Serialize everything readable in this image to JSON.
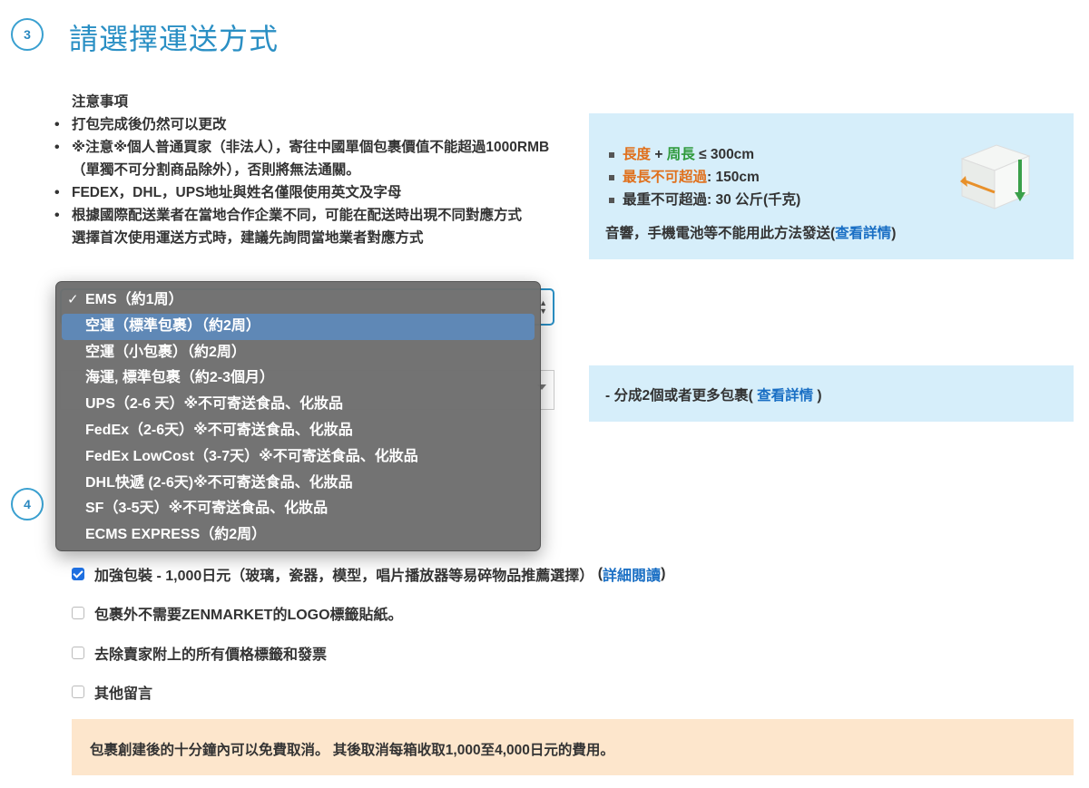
{
  "step3": {
    "number": "3",
    "title": "請選擇運送方式"
  },
  "step4": {
    "number": "4"
  },
  "notes": {
    "heading": "注意事項",
    "items": [
      "打包完成後仍然可以更改",
      "※注意※個人普通買家（非法人），寄往中國單個包裹價值不能超過1000RMB（單獨不可分割商品除外），否則將無法通關。",
      "FEDEX，DHL，UPS地址與姓名僅限使用英文及字母",
      "根據國際配送業者在當地合作企業不同，可能在配送時出現不同對應方式"
    ],
    "tail": "選擇首次使用運送方式時，建議先詢問當地業者對應方式"
  },
  "info_box": {
    "line1": {
      "a": "長度",
      "plus": " + ",
      "b": "周長",
      "c": " ≤ 300cm"
    },
    "line2": {
      "a": "最長不可超過",
      "b": ":  150cm"
    },
    "line3": "最重不可超過: 30 公斤(千克)",
    "note_prefix": "音響，手機電池等不能用此方法發送(",
    "note_link": "查看詳情",
    "note_suffix": ")"
  },
  "info_box2": {
    "prefix": "- 分成2個或者更多包裹( ",
    "link": "查看詳情",
    "suffix": " )"
  },
  "dropdown": {
    "selected_index": 0,
    "highlighted_index": 1,
    "check": "✓",
    "options": [
      "EMS（約1周）",
      "空運（標準包裹）（約2周）",
      "空運（小包裹）（約2周）",
      "海運, 標準包裹（約2-3個月）",
      "UPS（2-6 天）※不可寄送食品、化妝品",
      "FedEx（2-6天）※不可寄送食品、化妝品",
      "FedEx LowCost（3-7天）※不可寄送食品、化妝品",
      "DHL快遞 (2-6天)※不可寄送食品、化妝品",
      "SF（3-5天）※不可寄送食品、化妝品",
      "ECMS EXPRESS（約2周）"
    ]
  },
  "options": [
    {
      "label": "加強包裝 - 1,000日元（玻璃，瓷器，模型，唱片播放器等易碎物品推薦選擇）",
      "link_prefix": "(",
      "link": "詳細閱讀",
      "link_suffix": ")",
      "checked": true
    },
    {
      "label": "包裹外不需要ZENMARKET的LOGO標籤貼紙。",
      "checked": false
    },
    {
      "label": "去除賣家附上的所有價格標籤和發票",
      "checked": false
    },
    {
      "label": "其他留言",
      "checked": false
    }
  ],
  "warning": "包裹創建後的十分鐘內可以免費取消。 其後取消每箱收取1,000至4,000日元的費用。"
}
